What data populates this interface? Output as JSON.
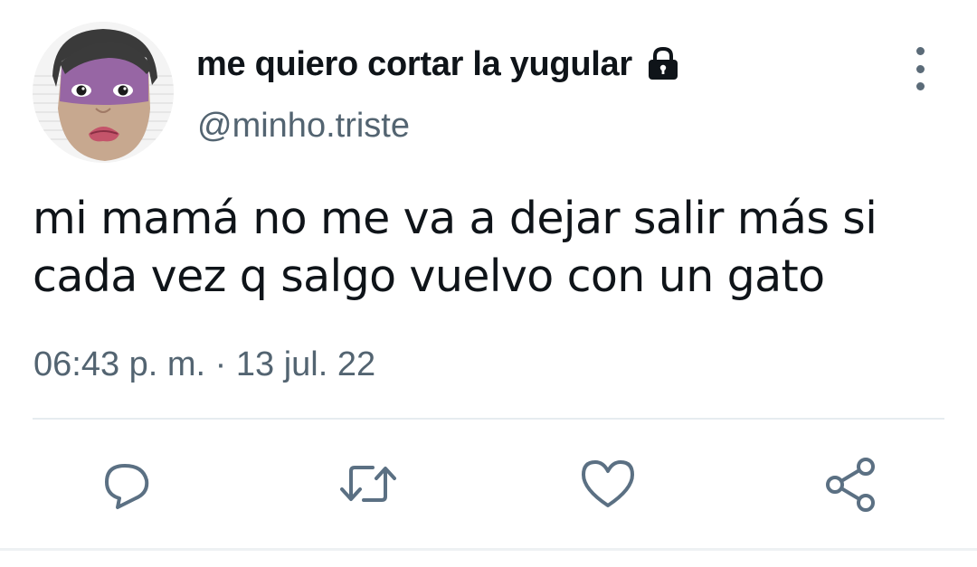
{
  "tweet": {
    "display_name": "me quiero cortar la yugular",
    "handle": "@minho.triste",
    "text_line1": "mi mamá no me va a dejar salir más si",
    "text_line2": "cada vez q salgo vuelvo con un gato",
    "timestamp": "06:43 p. m. · 13 jul. 22",
    "protected_icon": "lock-icon",
    "avatar_icon": "profile-photo"
  },
  "actions": {
    "reply_icon": "reply-icon",
    "retweet_icon": "retweet-icon",
    "like_icon": "like-icon",
    "share_icon": "share-icon"
  },
  "colors": {
    "text_primary": "#0f1419",
    "text_secondary": "#536471",
    "icon": "#5b7083",
    "divider": "#e6ecf0"
  }
}
